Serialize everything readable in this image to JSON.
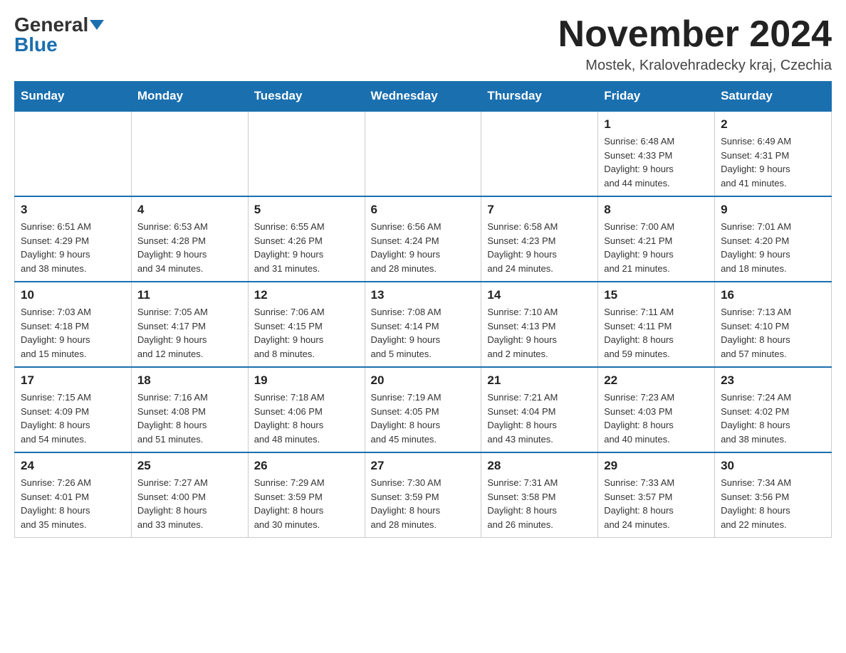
{
  "header": {
    "logo_general": "General",
    "logo_blue": "Blue",
    "month_title": "November 2024",
    "location": "Mostek, Kralovehradecky kraj, Czechia"
  },
  "weekdays": [
    "Sunday",
    "Monday",
    "Tuesday",
    "Wednesday",
    "Thursday",
    "Friday",
    "Saturday"
  ],
  "weeks": [
    [
      {
        "day": "",
        "info": ""
      },
      {
        "day": "",
        "info": ""
      },
      {
        "day": "",
        "info": ""
      },
      {
        "day": "",
        "info": ""
      },
      {
        "day": "",
        "info": ""
      },
      {
        "day": "1",
        "info": "Sunrise: 6:48 AM\nSunset: 4:33 PM\nDaylight: 9 hours\nand 44 minutes."
      },
      {
        "day": "2",
        "info": "Sunrise: 6:49 AM\nSunset: 4:31 PM\nDaylight: 9 hours\nand 41 minutes."
      }
    ],
    [
      {
        "day": "3",
        "info": "Sunrise: 6:51 AM\nSunset: 4:29 PM\nDaylight: 9 hours\nand 38 minutes."
      },
      {
        "day": "4",
        "info": "Sunrise: 6:53 AM\nSunset: 4:28 PM\nDaylight: 9 hours\nand 34 minutes."
      },
      {
        "day": "5",
        "info": "Sunrise: 6:55 AM\nSunset: 4:26 PM\nDaylight: 9 hours\nand 31 minutes."
      },
      {
        "day": "6",
        "info": "Sunrise: 6:56 AM\nSunset: 4:24 PM\nDaylight: 9 hours\nand 28 minutes."
      },
      {
        "day": "7",
        "info": "Sunrise: 6:58 AM\nSunset: 4:23 PM\nDaylight: 9 hours\nand 24 minutes."
      },
      {
        "day": "8",
        "info": "Sunrise: 7:00 AM\nSunset: 4:21 PM\nDaylight: 9 hours\nand 21 minutes."
      },
      {
        "day": "9",
        "info": "Sunrise: 7:01 AM\nSunset: 4:20 PM\nDaylight: 9 hours\nand 18 minutes."
      }
    ],
    [
      {
        "day": "10",
        "info": "Sunrise: 7:03 AM\nSunset: 4:18 PM\nDaylight: 9 hours\nand 15 minutes."
      },
      {
        "day": "11",
        "info": "Sunrise: 7:05 AM\nSunset: 4:17 PM\nDaylight: 9 hours\nand 12 minutes."
      },
      {
        "day": "12",
        "info": "Sunrise: 7:06 AM\nSunset: 4:15 PM\nDaylight: 9 hours\nand 8 minutes."
      },
      {
        "day": "13",
        "info": "Sunrise: 7:08 AM\nSunset: 4:14 PM\nDaylight: 9 hours\nand 5 minutes."
      },
      {
        "day": "14",
        "info": "Sunrise: 7:10 AM\nSunset: 4:13 PM\nDaylight: 9 hours\nand 2 minutes."
      },
      {
        "day": "15",
        "info": "Sunrise: 7:11 AM\nSunset: 4:11 PM\nDaylight: 8 hours\nand 59 minutes."
      },
      {
        "day": "16",
        "info": "Sunrise: 7:13 AM\nSunset: 4:10 PM\nDaylight: 8 hours\nand 57 minutes."
      }
    ],
    [
      {
        "day": "17",
        "info": "Sunrise: 7:15 AM\nSunset: 4:09 PM\nDaylight: 8 hours\nand 54 minutes."
      },
      {
        "day": "18",
        "info": "Sunrise: 7:16 AM\nSunset: 4:08 PM\nDaylight: 8 hours\nand 51 minutes."
      },
      {
        "day": "19",
        "info": "Sunrise: 7:18 AM\nSunset: 4:06 PM\nDaylight: 8 hours\nand 48 minutes."
      },
      {
        "day": "20",
        "info": "Sunrise: 7:19 AM\nSunset: 4:05 PM\nDaylight: 8 hours\nand 45 minutes."
      },
      {
        "day": "21",
        "info": "Sunrise: 7:21 AM\nSunset: 4:04 PM\nDaylight: 8 hours\nand 43 minutes."
      },
      {
        "day": "22",
        "info": "Sunrise: 7:23 AM\nSunset: 4:03 PM\nDaylight: 8 hours\nand 40 minutes."
      },
      {
        "day": "23",
        "info": "Sunrise: 7:24 AM\nSunset: 4:02 PM\nDaylight: 8 hours\nand 38 minutes."
      }
    ],
    [
      {
        "day": "24",
        "info": "Sunrise: 7:26 AM\nSunset: 4:01 PM\nDaylight: 8 hours\nand 35 minutes."
      },
      {
        "day": "25",
        "info": "Sunrise: 7:27 AM\nSunset: 4:00 PM\nDaylight: 8 hours\nand 33 minutes."
      },
      {
        "day": "26",
        "info": "Sunrise: 7:29 AM\nSunset: 3:59 PM\nDaylight: 8 hours\nand 30 minutes."
      },
      {
        "day": "27",
        "info": "Sunrise: 7:30 AM\nSunset: 3:59 PM\nDaylight: 8 hours\nand 28 minutes."
      },
      {
        "day": "28",
        "info": "Sunrise: 7:31 AM\nSunset: 3:58 PM\nDaylight: 8 hours\nand 26 minutes."
      },
      {
        "day": "29",
        "info": "Sunrise: 7:33 AM\nSunset: 3:57 PM\nDaylight: 8 hours\nand 24 minutes."
      },
      {
        "day": "30",
        "info": "Sunrise: 7:34 AM\nSunset: 3:56 PM\nDaylight: 8 hours\nand 22 minutes."
      }
    ]
  ]
}
